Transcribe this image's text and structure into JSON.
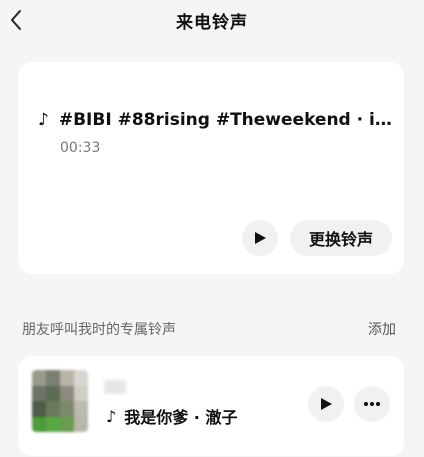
{
  "header": {
    "title": "来电铃声"
  },
  "current_ringtone": {
    "note_glyph": "♪",
    "song_title": "#BIBI #88rising #Theweekend · im…",
    "duration": "00:33",
    "change_label": "更换铃声"
  },
  "friends_section": {
    "label": "朋友呼叫我时的专属铃声",
    "add_label": "添加"
  },
  "friend_item": {
    "note_glyph": "♪",
    "song": "我是你爹 · 澈子"
  },
  "icons": {
    "back": "chevron-left-icon",
    "play": "play-icon",
    "more": "more-dots-icon",
    "note": "music-note-icon"
  },
  "colors": {
    "background": "#f5f5f5",
    "card": "#ffffff",
    "button_bg": "#f1f1f1",
    "text_primary": "#111111",
    "text_secondary": "#777777"
  }
}
